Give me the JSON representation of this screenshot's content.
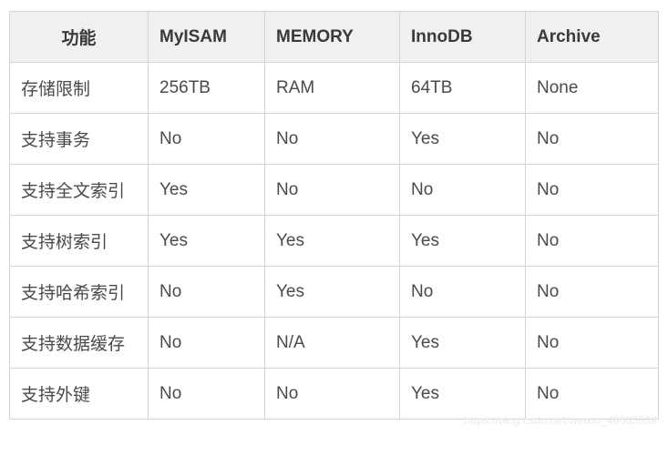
{
  "chart_data": {
    "type": "table",
    "headers": [
      "功能",
      "MyISAM",
      "MEMORY",
      "InnoDB",
      "Archive"
    ],
    "rows": [
      [
        "存储限制",
        "256TB",
        "RAM",
        "64TB",
        "None"
      ],
      [
        "支持事务",
        "No",
        "No",
        "Yes",
        "No"
      ],
      [
        "支持全文索引",
        "Yes",
        "No",
        "No",
        "No"
      ],
      [
        "支持树索引",
        "Yes",
        "Yes",
        "Yes",
        "No"
      ],
      [
        "支持哈希索引",
        "No",
        "Yes",
        "No",
        "No"
      ],
      [
        "支持数据缓存",
        "No",
        "N/A",
        "Yes",
        "No"
      ],
      [
        "支持外键",
        "No",
        "No",
        "Yes",
        "No"
      ]
    ]
  },
  "watermark": "https://blog.csdn.net/weixin_40065538"
}
